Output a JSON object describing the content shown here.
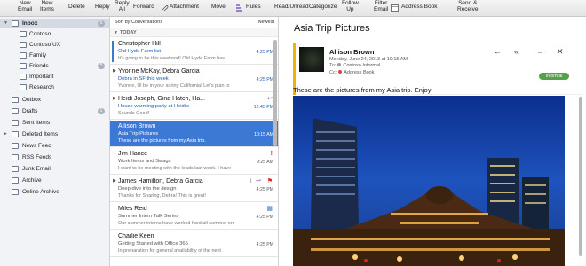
{
  "toolbar": {
    "new_email": [
      "New",
      "Email"
    ],
    "new_items": [
      "New",
      "Items"
    ],
    "delete": "Delete",
    "reply": "Reply",
    "reply_all": [
      "Reply",
      "All"
    ],
    "forward": "Forward",
    "attachment": "Attachment",
    "move": "Move",
    "rules": "Rules",
    "read_unread": "Read/Unread",
    "categorize": "Categorize",
    "follow_up": [
      "Follow",
      "Up"
    ],
    "filter_email": [
      "Filter",
      "Email"
    ],
    "address_book": "Address Book",
    "send_receive": [
      "Send &",
      "Receive"
    ]
  },
  "sidebar": {
    "inbox": {
      "label": "Inbox",
      "count": "5"
    },
    "accounts": [
      "Contoso",
      "Contoso UX",
      "Family",
      "Friends",
      "Important",
      "Research"
    ],
    "friends_count": "5",
    "folders": [
      "Outbox",
      "Drafts",
      "Sent Items",
      "Deleted Items",
      "News Feed",
      "RSS Feeds",
      "Junk Email",
      "Archive",
      "Online Archive"
    ],
    "drafts_count": "1"
  },
  "message_list": {
    "sort_label": "Sort by Conversations",
    "sort_dir": "Newest",
    "group": "TODAY",
    "messages": [
      {
        "from": "Christopher Hill",
        "subject": "Old Hyde Farm list",
        "preview": "It's going to be this weekend! Old Hyde Farm has",
        "time": "4:25 PM"
      },
      {
        "from": "Yvonne McKay, Debra Garcia",
        "subject": "Debra in SF this week",
        "preview": "Yvonne, I'll be in your sunny California! Let's plan to",
        "time": "4:25 PM"
      },
      {
        "from": "Heidi Joseph, Gina Hatch, Ha...",
        "subject": "House warming party at Heidi's",
        "preview": "Sounds Good!",
        "time": "12:45 PM"
      },
      {
        "from": "Allison Brown",
        "subject": "Asia Trip Pictures",
        "preview": "These are the pictures from my Asia trip.",
        "time": "10:15 AM"
      },
      {
        "from": "Jim Hance",
        "subject": "Work Items and Swags",
        "preview": "I want to be meeting with the leads last week. I have",
        "time": "9:25 AM"
      },
      {
        "from": "James Hamilton, Debra Garcia",
        "subject": "Deep dive into the design",
        "preview": "Thanks for Sharing, Debra! This is great!",
        "time": "4:25 PM"
      },
      {
        "from": "Miles Reid",
        "subject": "Summer Intern Talk Series",
        "preview": "Our summer interns have worked hard all summer on",
        "time": "4:25 PM"
      },
      {
        "from": "Charlie Keen",
        "subject": "Getting Started with Office 365",
        "preview": "In preparation for general availability of the next",
        "time": "4:25 PM"
      }
    ]
  },
  "reading": {
    "subject": "Asia Trip Pictures",
    "from": "Allison Brown",
    "date": "Monday, June 24, 2013 at 10:15 AM",
    "to_label": "To:",
    "to": "Contoso Informal",
    "cc_label": "Cc:",
    "cc": "Address Book",
    "category": "Informal",
    "body": "These are the pictures from my Asia trip.   Enjoy!"
  },
  "colors": {
    "accent": "#3b79d4",
    "category_green": "#55a04a",
    "sender_bar": "#f0b400",
    "flag_red": "#e02020"
  }
}
